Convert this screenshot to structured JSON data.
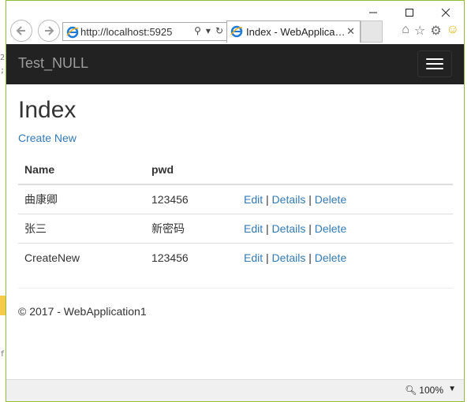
{
  "browser": {
    "address_url": "http://localhost:5925",
    "tab_title": "Index - WebApplica…",
    "zoom": "100%"
  },
  "navbar": {
    "brand": "Test_NULL"
  },
  "page": {
    "heading": "Index",
    "create_link": "Create New",
    "columns": [
      "Name",
      "pwd"
    ],
    "rows": [
      {
        "name": "曲康卿",
        "pwd": "123456"
      },
      {
        "name": "张三",
        "pwd": "新密码"
      },
      {
        "name": "CreateNew",
        "pwd": "123456"
      }
    ],
    "actions": {
      "edit": "Edit",
      "details": "Details",
      "delete": "Delete",
      "separator": "|"
    },
    "footer": "© 2017 - WebApplication1"
  },
  "background": {
    "chars": [
      "2",
      ";",
      "f",
      "r"
    ]
  }
}
